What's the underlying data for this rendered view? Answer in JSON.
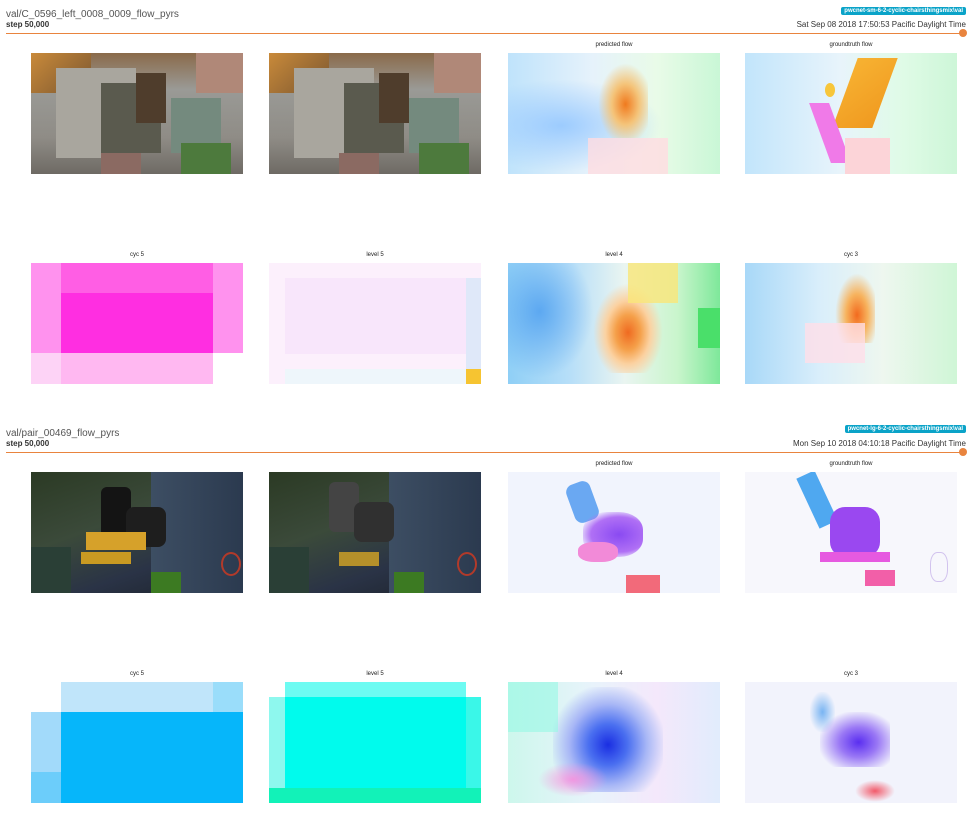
{
  "runs": [
    {
      "title": "val/C_0596_left_0008_0009_flow_pyrs",
      "step": "step 50,000",
      "tag": "pwcnet-sm-6-2-cyclic-chairsthingsmix\\val",
      "timestamp": "Sat Sep 08 2018 17:50:53 Pacific Daylight Time",
      "labels": [
        "",
        "",
        "predicted flow",
        "groundtruth flow",
        "cyc 5",
        "level 5",
        "level 4",
        "cyc 3"
      ]
    },
    {
      "title": "val/pair_00469_flow_pyrs",
      "step": "step 50,000",
      "tag": "pwcnet-lg-6-2-cyclic-chairsthingsmix\\val",
      "timestamp": "Mon Sep 10 2018 04:10:18 Pacific Daylight Time",
      "labels": [
        "",
        "",
        "predicted flow",
        "groundtruth flow",
        "cyc 5",
        "level 5",
        "level 4",
        "cyc 3"
      ]
    }
  ],
  "colors": {
    "accent_line": "#e9843e",
    "run_tag": "#0aa3c8"
  }
}
